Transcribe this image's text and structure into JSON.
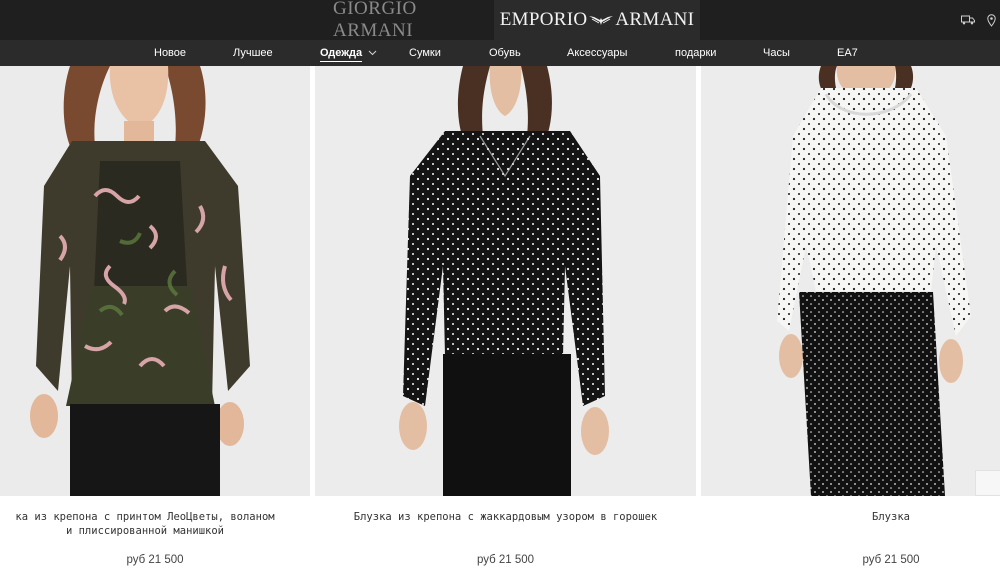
{
  "brands": {
    "giorgio": "GIORGIO ARMANI",
    "emporio_left": "EMPORIO",
    "emporio_right": "ARMANI"
  },
  "icons": [
    "truck-icon",
    "location-pin-icon",
    "eagle-logo-icon",
    "chevron-down-icon"
  ],
  "nav": {
    "items": [
      {
        "label": "Новое"
      },
      {
        "label": "Лучшее"
      },
      {
        "label": "Одежда"
      },
      {
        "label": "Сумки"
      },
      {
        "label": "Обувь"
      },
      {
        "label": "Аксессуары"
      },
      {
        "label": "подарки"
      },
      {
        "label": "Часы"
      },
      {
        "label": "EA7"
      }
    ],
    "active": "Одежда"
  },
  "products": [
    {
      "title_line1": "ка из крепона с принтом ЛеоЦветы, воланом",
      "title_line2": "и плиссированной манишкой",
      "price": "руб 21 500"
    },
    {
      "title_line1": "Блузка из крепона с жаккардовым узором в горошек",
      "title_line2": "",
      "price": "руб 21 500"
    },
    {
      "title_line1": "Блузка",
      "title_line2": "",
      "price": "руб 21 500"
    }
  ],
  "colors": {
    "brandbar": "#1f1f1f",
    "navbar": "#2b2b2b",
    "photo_bg": "#ececec"
  }
}
